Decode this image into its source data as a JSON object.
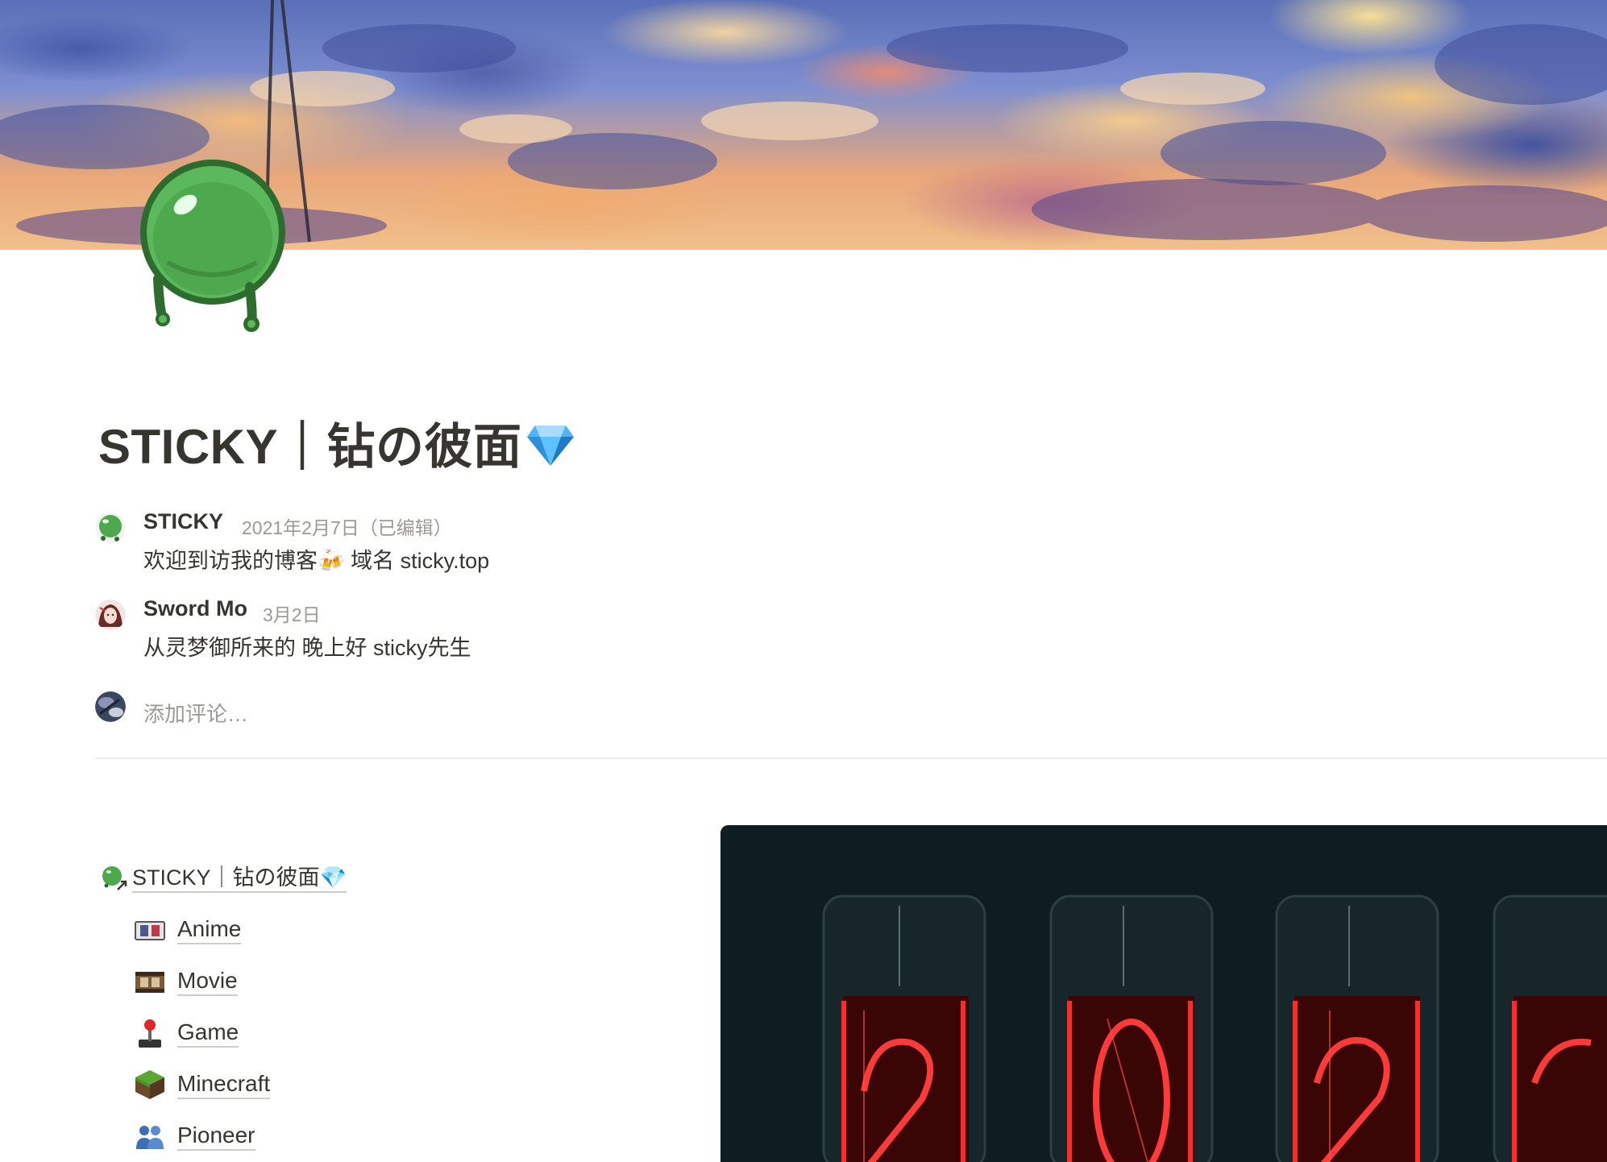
{
  "page": {
    "title": "STICKY｜钻の彼面",
    "title_emoji": "💎"
  },
  "comments": [
    {
      "author": "STICKY",
      "date": "2021年2月7日（已编辑）",
      "body": "欢迎到访我的博客🍻 域名 sticky.top"
    },
    {
      "author": "Sword Mo",
      "date": "3月2日",
      "body": "从灵梦御所来的 晚上好 sticky先生"
    }
  ],
  "add_comment": {
    "placeholder": "添加评论…"
  },
  "link_tree": {
    "root": "STICKY｜钻の彼面💎",
    "children": [
      {
        "label": "Anime",
        "icon": "anime-icon"
      },
      {
        "label": "Movie",
        "icon": "film-icon"
      },
      {
        "label": "Game",
        "icon": "joystick-icon"
      },
      {
        "label": "Minecraft",
        "icon": "grass-block-icon"
      },
      {
        "label": "Pioneer",
        "icon": "people-icon"
      }
    ]
  },
  "colors": {
    "text": "#37352f",
    "muted": "#9b9a97",
    "divider": "#ececeb",
    "nixie_red": "#ff2a2a"
  }
}
